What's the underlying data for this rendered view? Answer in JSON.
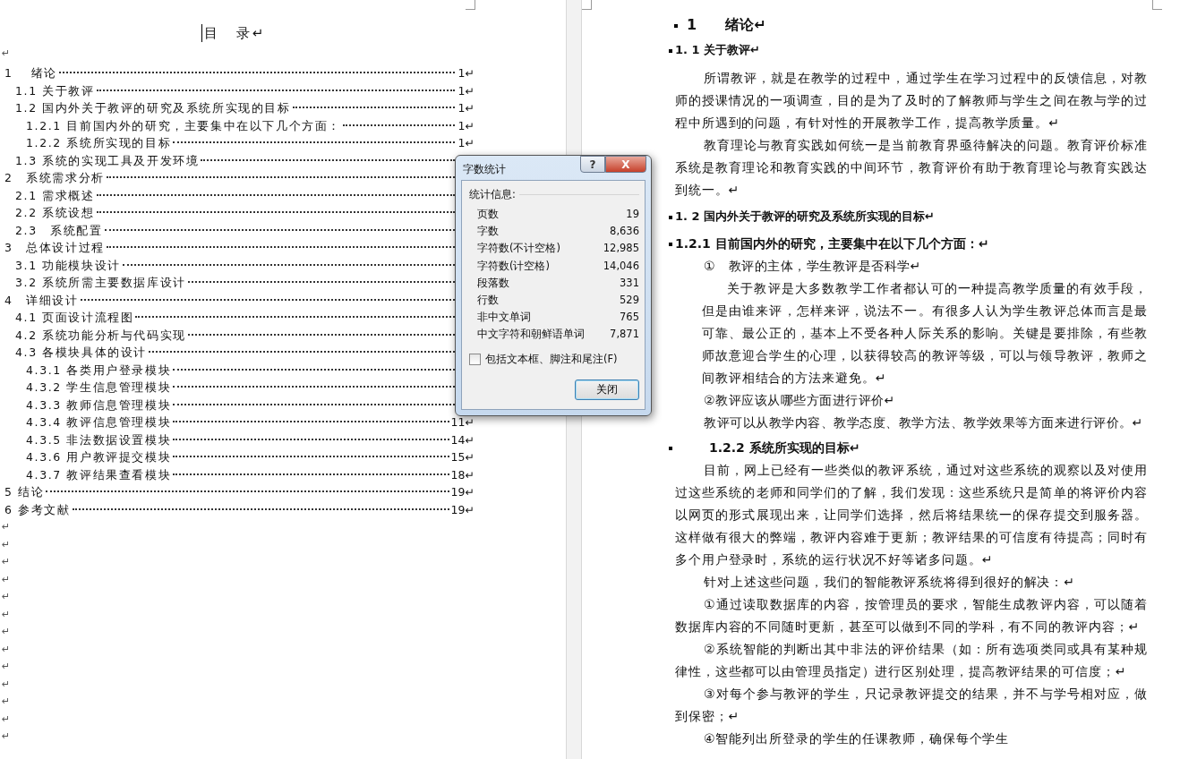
{
  "left_page": {
    "toc_title": "目　录↵",
    "blank_before": "↵",
    "toc": [
      {
        "title": "1　 绪论",
        "page": "1↵",
        "children": [
          {
            "title": "1.1 关于教评",
            "page": "1↵"
          },
          {
            "title": "1.2 国内外关于教评的研究及系统所实现的目标",
            "page": "1↵",
            "children": [
              {
                "title": "1.2.1 目前国内外的研究，主要集中在以下几个方面：",
                "page": "1↵"
              },
              {
                "title": "1.2.2 系统所实现的目标",
                "page": "1↵"
              }
            ]
          },
          {
            "title": "1.3 系统的实现工具及开发环境"
          }
        ]
      },
      {
        "title": "2　系统需求分析",
        "children": [
          {
            "title": "2.1 需求概述"
          },
          {
            "title": "2.2 系统设想"
          },
          {
            "title": "2.3　系统配置"
          }
        ]
      },
      {
        "title": "3　总体设计过程",
        "children": [
          {
            "title": "3.1 功能模块设计"
          },
          {
            "title": "3.2 系统所需主要数据库设计"
          }
        ]
      },
      {
        "title": "4　详细设计",
        "children": [
          {
            "title": "4.1 页面设计流程图"
          },
          {
            "title": "4.2 系统功能分析与代码实现"
          },
          {
            "title": "4.3 各模块具体的设计",
            "children": [
              {
                "title": "4.3.1 各类用户登录模块"
              },
              {
                "title": "4.3.2 学生信息管理模块"
              },
              {
                "title": "4.3.3 教师信息管理模块"
              },
              {
                "title": "4.3.4 教评信息管理模块",
                "page": "11↵"
              },
              {
                "title": "4.3.5 非法数据设置模块",
                "page": "14↵"
              },
              {
                "title": "4.3.6 用户教评提交模块",
                "page": "15↵"
              },
              {
                "title": "4.3.7 教评结果查看模块",
                "page": "18↵"
              }
            ]
          }
        ]
      },
      {
        "title": "5 结论",
        "page": "19↵"
      },
      {
        "title": "6 参考文献",
        "page": "19↵"
      }
    ],
    "empty_paragraphs": [
      "↵",
      "↵",
      "↵",
      "↵",
      "↵",
      "↵",
      "↵",
      "↵",
      "↵",
      "↵",
      "↵",
      "↵",
      "↵"
    ]
  },
  "right_page": {
    "blocks": [
      {
        "kind": "heading1",
        "text": "1　　绪论↵"
      },
      {
        "kind": "heading2",
        "text": "1. 1 关于教评↵"
      },
      {
        "kind": "para",
        "text": "所谓教评，就是在教学的过程中，通过学生在学习过程中的反馈信息，对教师的授课情况的一项调查，目的是为了及时的了解教师与学生之间在教与学的过程中所遇到的问题，有针对性的开展教学工作，提高教学质量。↵"
      },
      {
        "kind": "para",
        "text": "教育理论与教育实践如何统一是当前教育界亟待解决的问题。教育评价标准系统是教育理论和教育实践的中间环节，教育评价有助于教育理论与教育实践达到统一。↵"
      },
      {
        "kind": "heading2",
        "text": "1. 2 国内外关于教评的研究及系统所实现的目标↵"
      },
      {
        "kind": "heading3",
        "text": "1.2.1 目前国内外的研究，主要集中在以下几个方面：↵"
      },
      {
        "kind": "sub",
        "text": "①　教评的主体，学生教评是否科学↵"
      },
      {
        "kind": "subpara",
        "text": "关于教评是大多数教学工作者都认可的一种提高教学质量的有效手段，但是由谁来评，怎样来评，说法不一。有很多人认为学生教评总体而言是最可靠、最公正的，基本上不受各种人际关系的影响。关键是要排除，有些教师故意迎合学生的心理，以获得较高的教评等级，可以与领导教评，教师之间教评相结合的方法来避免。↵"
      },
      {
        "kind": "sub",
        "text": "②教评应该从哪些方面进行评价↵"
      },
      {
        "kind": "sub",
        "text": "教评可以从教学内容、教学态度、教学方法、教学效果等方面来进行评价。↵"
      },
      {
        "kind": "heading4",
        "text": "1.2.2 系统所实现的目标↵"
      },
      {
        "kind": "para",
        "text": "目前，网上已经有一些类似的教评系统，通过对这些系统的观察以及对使用过这些系统的老师和同学们的了解，我们发现：这些系统只是简单的将评价内容以网页的形式展现出来，让同学们选择，然后将结果统一的保存提交到服务器。这样做有很大的弊端，教评内容难于更新；教评结果的可信度有待提高；同时有多个用户登录时，系统的运行状况不好等诸多问题。↵"
      },
      {
        "kind": "para",
        "text": "针对上述这些问题，我们的智能教评系统将得到很好的解决：↵"
      },
      {
        "kind": "para",
        "text": "①通过读取数据库的内容，按管理员的要求，智能生成教评内容，可以随着数据库内容的不同随时更新，甚至可以做到不同的学科，有不同的教评内容；↵"
      },
      {
        "kind": "para",
        "text": "②系统智能的判断出其中非法的评价结果（如：所有选项类同或具有某种规律性，这些都可以由管理员指定）进行区别处理，提高教评结果的可信度；↵"
      },
      {
        "kind": "para",
        "text": "③对每个参与教评的学生，只记录教评提交的结果，并不与学号相对应，做到保密；↵"
      },
      {
        "kind": "para",
        "text": "④智能列出所登录的学生的任课教师，确保每个学生"
      }
    ]
  },
  "dialog": {
    "title": "字数统计",
    "help": "?",
    "close": "X",
    "group_label": "统计信息:",
    "stats": [
      {
        "label": "页数",
        "value": "19"
      },
      {
        "label": "字数",
        "value": "8,636"
      },
      {
        "label": "字符数(不计空格)",
        "value": "12,985"
      },
      {
        "label": "字符数(计空格)",
        "value": "14,046"
      },
      {
        "label": "段落数",
        "value": "331"
      },
      {
        "label": "行数",
        "value": "529"
      },
      {
        "label": "非中文单词",
        "value": "765"
      },
      {
        "label": "中文字符和朝鲜语单词",
        "value": "7,871"
      }
    ],
    "option": {
      "label": "包括文本框、脚注和尾注(F)",
      "checked": false
    },
    "button": "关闭"
  }
}
